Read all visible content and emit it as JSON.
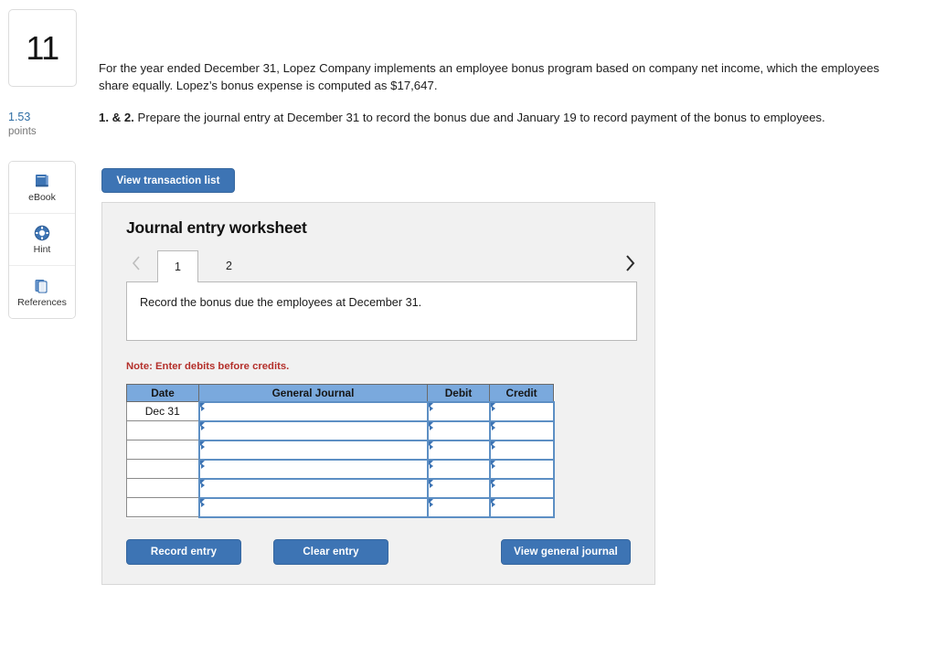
{
  "question": {
    "number": "11",
    "points_value": "1.53",
    "points_label": "points"
  },
  "tools": [
    {
      "label": "eBook",
      "icon": "book-icon"
    },
    {
      "label": "Hint",
      "icon": "lifebuoy-icon"
    },
    {
      "label": "References",
      "icon": "copy-pages-icon"
    }
  ],
  "prompt": {
    "paragraph1": "For the year ended December 31, Lopez Company implements an employee bonus program based on company net income, which the employees share equally. Lopez’s bonus expense is computed as $17,647.",
    "requirement_label": "1. & 2.",
    "requirement_text": " Prepare the journal entry at December 31 to record the bonus due and January 19 to record payment of the bonus to employees."
  },
  "toolbar": {
    "view_transaction_list": "View transaction list"
  },
  "worksheet": {
    "title": "Journal entry worksheet",
    "pager": {
      "prev_icon": "chevron-left-icon",
      "next_icon": "chevron-right-icon",
      "tabs": [
        {
          "label": "1",
          "active": true
        },
        {
          "label": "2",
          "active": false
        }
      ]
    },
    "description": "Record the bonus due the employees at December 31.",
    "note": "Note: Enter debits before credits.",
    "table": {
      "headers": [
        "Date",
        "General Journal",
        "Debit",
        "Credit"
      ],
      "rows": [
        {
          "date": "Dec 31",
          "general_journal": "",
          "debit": "",
          "credit": ""
        },
        {
          "date": "",
          "general_journal": "",
          "debit": "",
          "credit": ""
        },
        {
          "date": "",
          "general_journal": "",
          "debit": "",
          "credit": ""
        },
        {
          "date": "",
          "general_journal": "",
          "debit": "",
          "credit": ""
        },
        {
          "date": "",
          "general_journal": "",
          "debit": "",
          "credit": ""
        },
        {
          "date": "",
          "general_journal": "",
          "debit": "",
          "credit": ""
        }
      ]
    },
    "buttons": {
      "record_entry": "Record entry",
      "clear_entry": "Clear entry",
      "view_general_journal": "View general journal"
    }
  },
  "colors": {
    "accent_button": "#3d74b4",
    "table_header": "#7aa9dd",
    "note_red": "#b4302b",
    "points_blue": "#2e6da4",
    "panel_bg": "#f1f1f1"
  }
}
